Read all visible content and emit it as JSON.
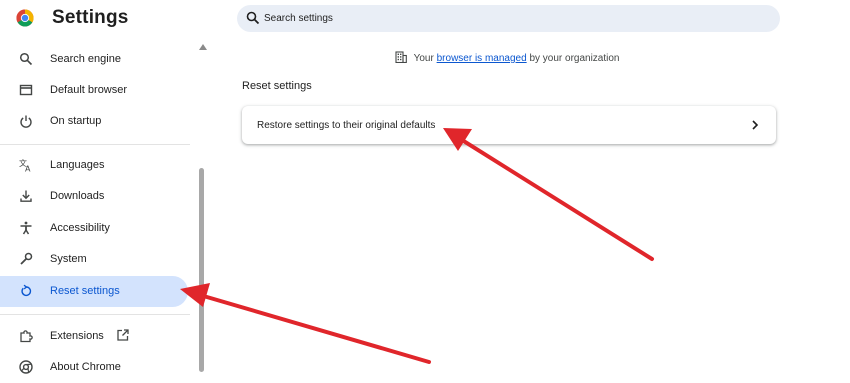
{
  "header": {
    "title": "Settings"
  },
  "search": {
    "placeholder": "Search settings"
  },
  "sidebar": {
    "items": [
      {
        "label": "Search engine",
        "icon": "search-icon"
      },
      {
        "label": "Default browser",
        "icon": "browser-window-icon"
      },
      {
        "label": "On startup",
        "icon": "power-icon"
      },
      {
        "label": "Languages",
        "icon": "translate-icon"
      },
      {
        "label": "Downloads",
        "icon": "download-icon"
      },
      {
        "label": "Accessibility",
        "icon": "accessibility-icon"
      },
      {
        "label": "System",
        "icon": "wrench-icon"
      },
      {
        "label": "Reset settings",
        "icon": "reset-icon",
        "selected": true
      },
      {
        "label": "Extensions",
        "icon": "puzzle-icon"
      },
      {
        "label": "About Chrome",
        "icon": "chrome-icon"
      }
    ]
  },
  "managed": {
    "prefix": "Your",
    "link": "browser is managed",
    "suffix": "by your organization"
  },
  "main": {
    "section_title": "Reset settings",
    "restore_label": "Restore settings to their original defaults"
  },
  "colors": {
    "accent": "#0b57d0",
    "selected_bg": "#d3e3fd",
    "search_bg": "#e9eef6",
    "annotation_arrow": "#e0262b"
  }
}
